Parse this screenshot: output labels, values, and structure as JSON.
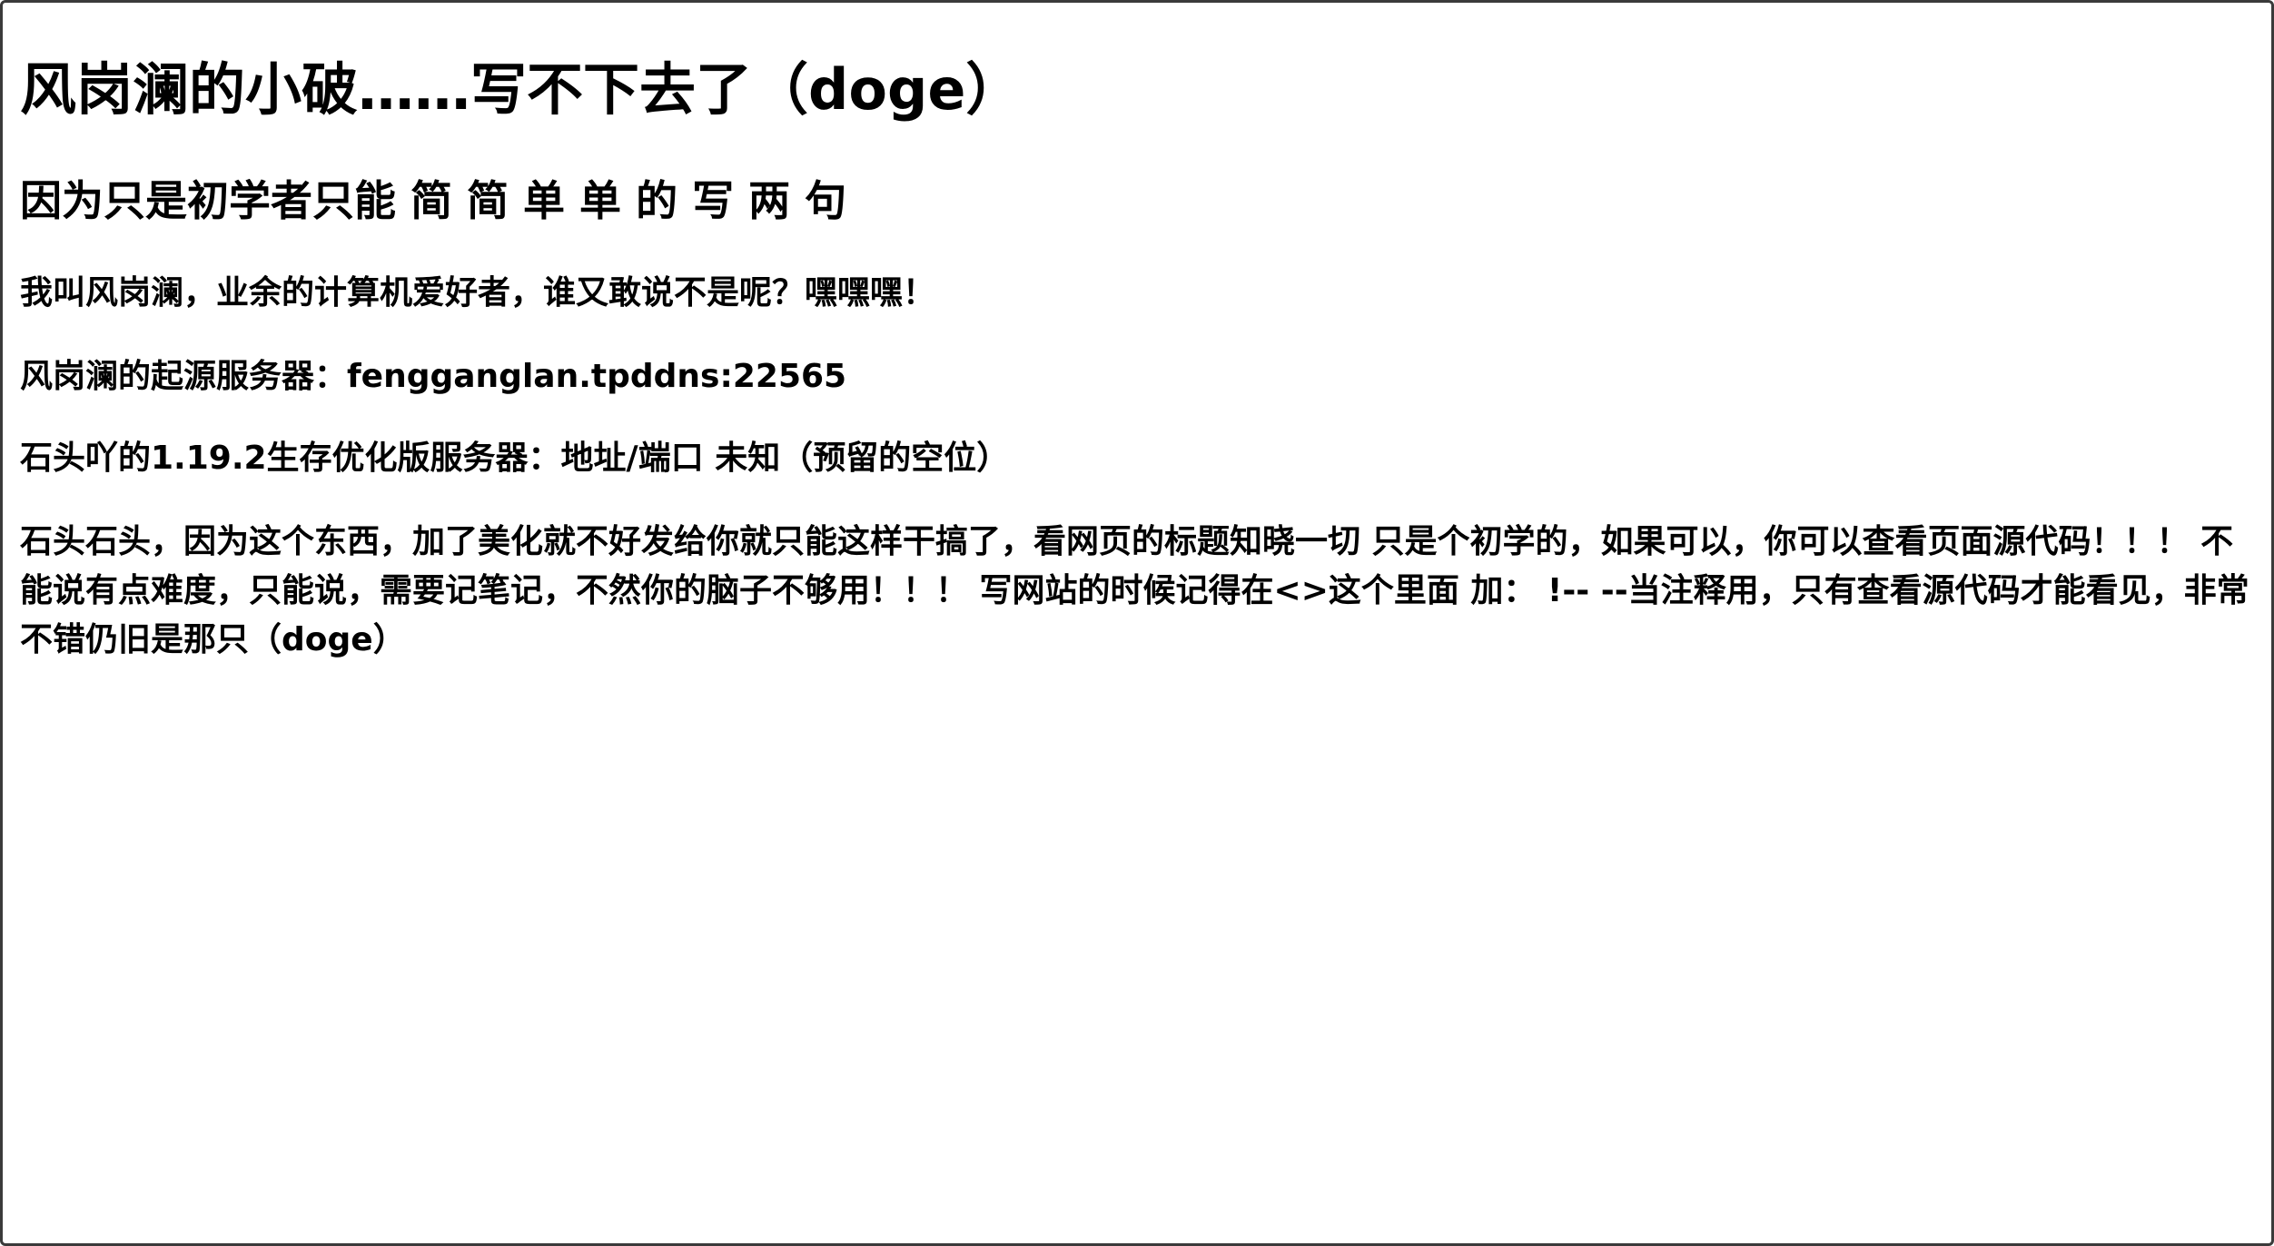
{
  "page": {
    "heading": "风岗澜的小破……写不下去了（doge）",
    "subheading": "因为只是初学者只能 简 简 单 单 的 写 两 句",
    "paragraphs": [
      "我叫风岗澜，业余的计算机爱好者，谁又敢说不是呢？嘿嘿嘿！",
      "风岗澜的起源服务器：fengganglan.tpddns:22565",
      "石头吖的1.19.2生存优化版服务器：地址/端口 未知（预留的空位）",
      "石头石头，因为这个东西，加了美化就不好发给你就只能这样干搞了，看网页的标题知晓一切 只是个初学的，如果可以，你可以查看页面源代码！！！ 不能说有点难度，只能说，需要记笔记，不然你的脑子不够用！！！ 写网站的时候记得在<>这个里面 加： !-- --当注释用，只有查看源代码才能看见，非常不错仍旧是那只（doge）"
    ]
  }
}
